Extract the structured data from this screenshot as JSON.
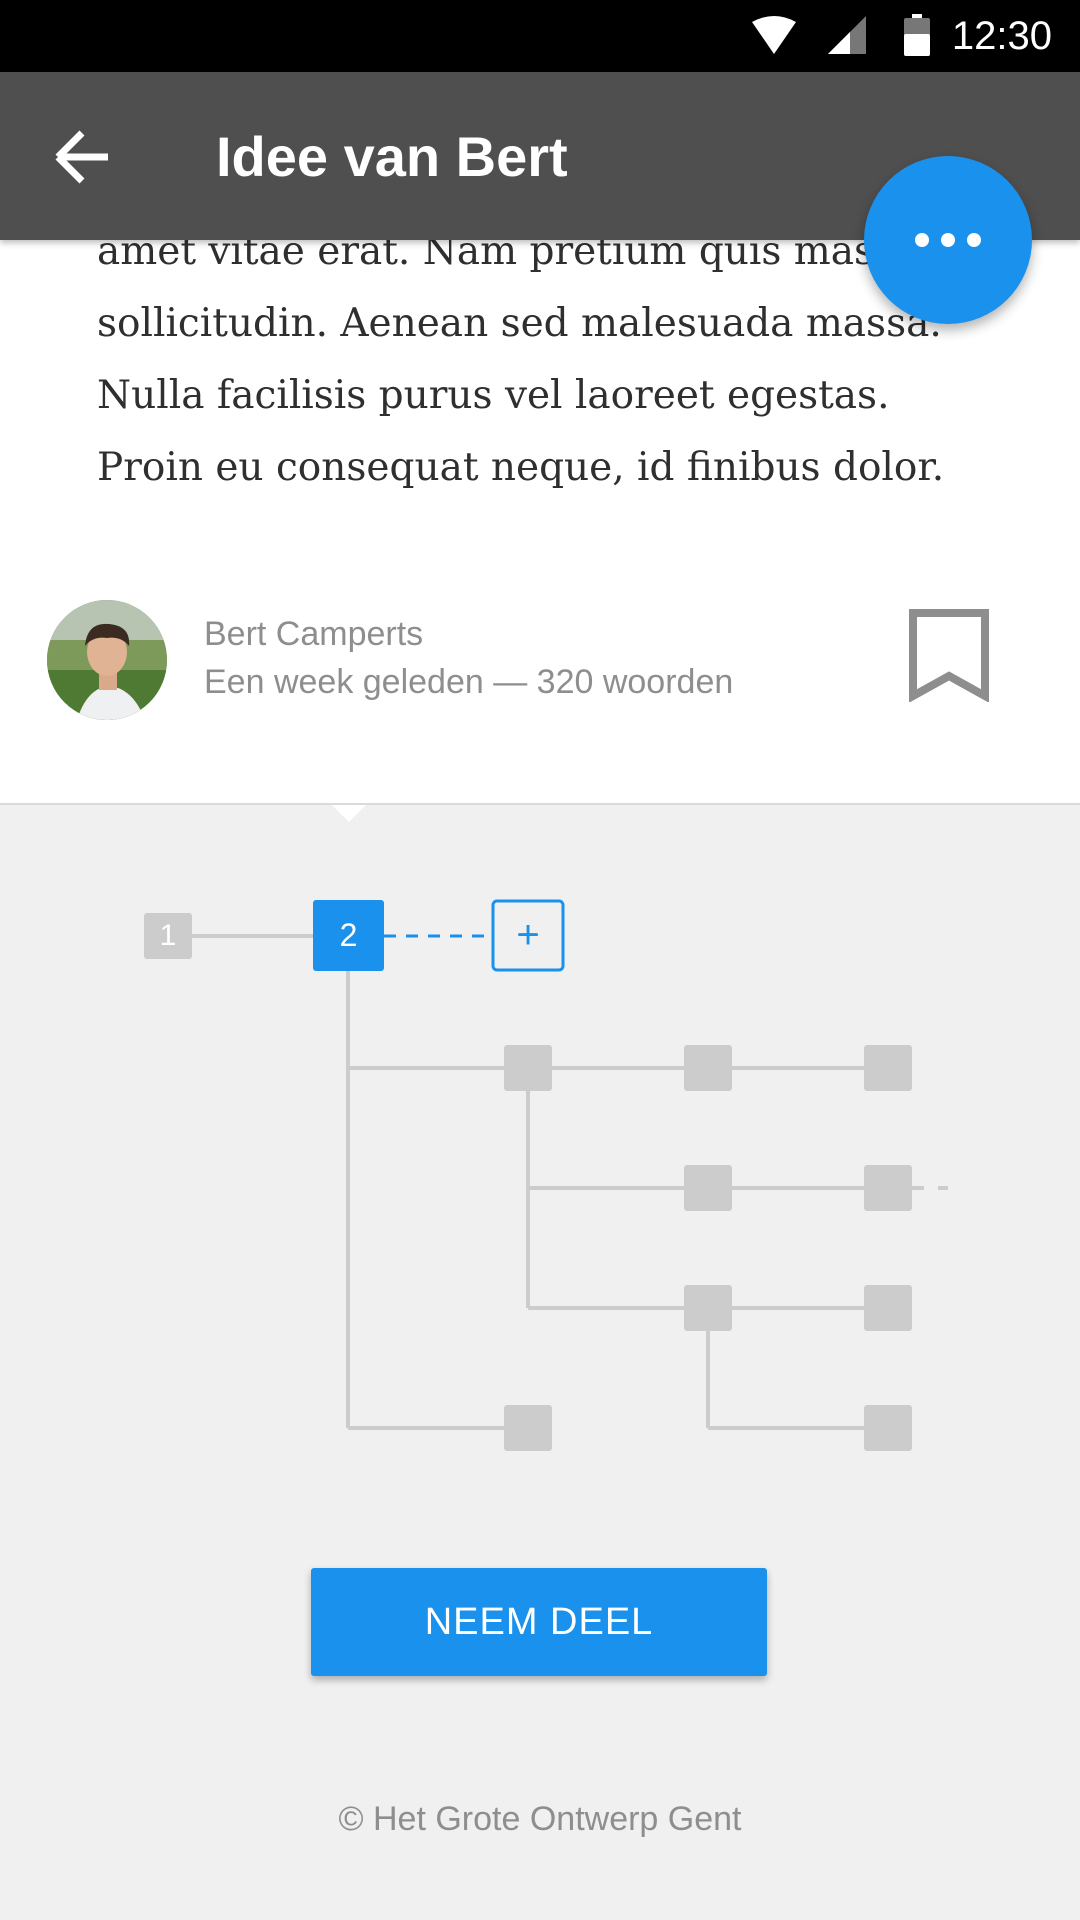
{
  "status_bar": {
    "time": "12:30",
    "icons": [
      "wifi-icon",
      "cell-signal-icon",
      "battery-icon"
    ]
  },
  "app_bar": {
    "title": "Idee van Bert",
    "back_icon": "arrow-back-icon"
  },
  "fab": {
    "icon": "more-horizontal-icon"
  },
  "article": {
    "body_text": "amet vitae erat. Nam pretium quis massa sollicitudin. Aenean sed malesuada massa. Nulla facilisis purus vel laoreet egestas. Proin eu consequat neque, id finibus dolor.",
    "author_name": "Bert Camperts",
    "meta": "Een week geleden — 320 woorden",
    "bookmark_icon": "bookmark-icon"
  },
  "tree": {
    "node_1_label": "1",
    "node_2_label": "2",
    "add_label": "+"
  },
  "actions": {
    "join_label": "NEEM DEEL"
  },
  "footer": {
    "text": "© Het Grote Ontwerp Gent"
  },
  "colors": {
    "accent": "#1a91ec",
    "app_bar": "#4f4f4f",
    "node_grey": "#cccccc",
    "background": "#f0f0f0"
  }
}
